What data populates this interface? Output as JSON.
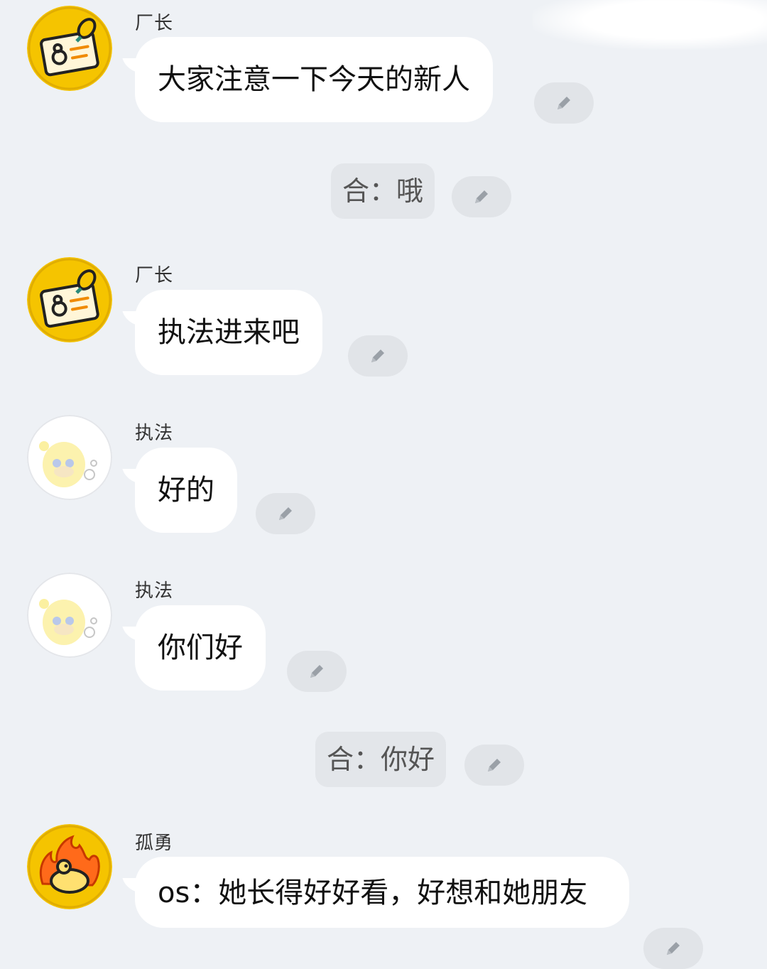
{
  "colors": {
    "background": "#eef1f5",
    "bubble": "#ffffff",
    "system_bubble": "#e3e6ea",
    "edit_button": "#e1e4e8",
    "avatar_yellow": "#f5c400"
  },
  "messages": [
    {
      "type": "user",
      "sender": "厂长",
      "avatar": "id-badge-icon",
      "text": "大家注意一下今天的新人"
    },
    {
      "type": "system",
      "text": "合：哦"
    },
    {
      "type": "user",
      "sender": "厂长",
      "avatar": "id-badge-icon",
      "text": "执法进来吧"
    },
    {
      "type": "user",
      "sender": "执法",
      "avatar": "cartoon-character-icon",
      "text": "好的"
    },
    {
      "type": "user",
      "sender": "执法",
      "avatar": "cartoon-character-icon",
      "text": "你们好"
    },
    {
      "type": "system",
      "text": "合：你好"
    },
    {
      "type": "user",
      "sender": "孤勇",
      "avatar": "flame-face-icon",
      "text": "os：她长得好好看，好想和她朋友"
    }
  ],
  "edit_icon": "pencil-icon"
}
